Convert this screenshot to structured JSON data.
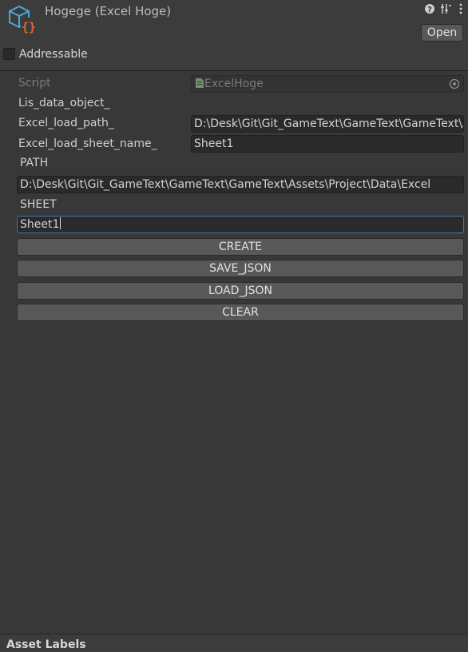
{
  "header": {
    "title": "Hogege (Excel Hoge)",
    "open_label": "Open",
    "addressable_label": "Addressable",
    "addressable_checked": false,
    "icons": [
      "script-asset-icon",
      "help-icon",
      "preset-icon",
      "more-icon"
    ]
  },
  "fields": {
    "script_label": "Script",
    "script_value": "ExcelHoge",
    "lis_label": "Lis_data_object_",
    "path_label": "Excel_load_path_",
    "path_value": "D:\\Desk\\Git\\Git_GameText\\GameText\\GameText\\Assets\\Project\\Data\\Excel",
    "sheet_label": "Excel_load_sheet_name_",
    "sheet_value": "Sheet1"
  },
  "custom": {
    "path_heading": "PATH",
    "path_input": "D:\\Desk\\Git\\Git_GameText\\GameText\\GameText\\Assets\\Project\\Data\\Excel",
    "sheet_heading": "SHEET",
    "sheet_input": "Sheet1"
  },
  "buttons": {
    "create": "CREATE",
    "save_json": "SAVE_JSON",
    "load_json": "LOAD_JSON",
    "clear": "CLEAR"
  },
  "footer": {
    "label": "Asset Labels"
  },
  "colors": {
    "background": "#383838",
    "focus_border": "#3a79bb",
    "icon_blue": "#4ea7d8",
    "icon_orange": "#e8643a"
  }
}
